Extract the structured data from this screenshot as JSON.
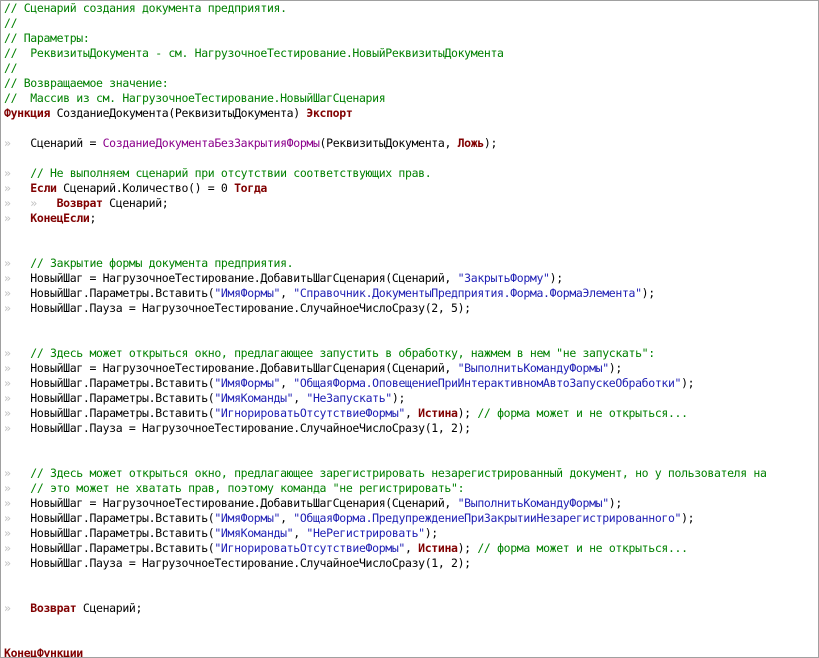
{
  "lines": [
    [
      {
        "t": "c",
        "v": "// Сценарий создания документа предприятия."
      }
    ],
    [
      {
        "t": "c",
        "v": "//"
      }
    ],
    [
      {
        "t": "c",
        "v": "// Параметры:"
      }
    ],
    [
      {
        "t": "c",
        "v": "//  РеквизитыДокумента - см. НагрузочноеТестирование.НовыйРеквизитыДокумента"
      }
    ],
    [
      {
        "t": "c",
        "v": "//"
      }
    ],
    [
      {
        "t": "c",
        "v": "// Возвращаемое значение:"
      }
    ],
    [
      {
        "t": "c",
        "v": "//  Массив из см. НагрузочноеТестирование.НовыйШагСценария"
      }
    ],
    [
      {
        "t": "k",
        "v": "Функция"
      },
      {
        "t": "p",
        "v": " СозданиеДокумента(РеквизитыДокумента) "
      },
      {
        "t": "k",
        "v": "Экспорт"
      }
    ],
    [],
    [
      {
        "t": "i",
        "v": "»   "
      },
      {
        "t": "p",
        "v": "Сценарий = "
      },
      {
        "t": "f",
        "v": "СозданиеДокументаБезЗакрытияФормы"
      },
      {
        "t": "p",
        "v": "(РеквизитыДокумента, "
      },
      {
        "t": "k",
        "v": "Ложь"
      },
      {
        "t": "p",
        "v": ");"
      }
    ],
    [],
    [
      {
        "t": "i",
        "v": "»   "
      },
      {
        "t": "c",
        "v": "// Не выполняем сценарий при отсутствии соответствующих прав."
      }
    ],
    [
      {
        "t": "i",
        "v": "»   "
      },
      {
        "t": "k",
        "v": "Если"
      },
      {
        "t": "p",
        "v": " Сценарий.Количество() = 0 "
      },
      {
        "t": "k",
        "v": "Тогда"
      }
    ],
    [
      {
        "t": "i",
        "v": "»   »   "
      },
      {
        "t": "k",
        "v": "Возврат"
      },
      {
        "t": "p",
        "v": " Сценарий;"
      }
    ],
    [
      {
        "t": "i",
        "v": "»   "
      },
      {
        "t": "k",
        "v": "КонецЕсли"
      },
      {
        "t": "p",
        "v": ";"
      }
    ],
    [],
    [],
    [
      {
        "t": "i",
        "v": "»   "
      },
      {
        "t": "c",
        "v": "// Закрытие формы документа предприятия."
      }
    ],
    [
      {
        "t": "i",
        "v": "»   "
      },
      {
        "t": "p",
        "v": "НовыйШаг = НагрузочноеТестирование.ДобавитьШагСценария(Сценарий, "
      },
      {
        "t": "s",
        "v": "\"ЗакрытьФорму\""
      },
      {
        "t": "p",
        "v": ");"
      }
    ],
    [
      {
        "t": "i",
        "v": "»   "
      },
      {
        "t": "p",
        "v": "НовыйШаг.Параметры.Вставить("
      },
      {
        "t": "s",
        "v": "\"ИмяФормы\""
      },
      {
        "t": "p",
        "v": ", "
      },
      {
        "t": "s",
        "v": "\"Справочник.ДокументыПредприятия.Форма.ФормаЭлемента\""
      },
      {
        "t": "p",
        "v": ");"
      }
    ],
    [
      {
        "t": "i",
        "v": "»   "
      },
      {
        "t": "p",
        "v": "НовыйШаг.Пауза = НагрузочноеТестирование.СлучайноеЧислоСразу(2, 5);"
      }
    ],
    [],
    [],
    [
      {
        "t": "i",
        "v": "»   "
      },
      {
        "t": "c",
        "v": "// Здесь может открыться окно, предлагающее запустить в обработку, нажмем в нем \"не запускать\":"
      }
    ],
    [
      {
        "t": "i",
        "v": "»   "
      },
      {
        "t": "p",
        "v": "НовыйШаг = НагрузочноеТестирование.ДобавитьШагСценария(Сценарий, "
      },
      {
        "t": "s",
        "v": "\"ВыполнитьКомандуФормы\""
      },
      {
        "t": "p",
        "v": ");"
      }
    ],
    [
      {
        "t": "i",
        "v": "»   "
      },
      {
        "t": "p",
        "v": "НовыйШаг.Параметры.Вставить("
      },
      {
        "t": "s",
        "v": "\"ИмяФормы\""
      },
      {
        "t": "p",
        "v": ", "
      },
      {
        "t": "s",
        "v": "\"ОбщаяФорма.ОповещениеПриИнтерактивномАвтоЗапускеОбработки\""
      },
      {
        "t": "p",
        "v": ");"
      }
    ],
    [
      {
        "t": "i",
        "v": "»   "
      },
      {
        "t": "p",
        "v": "НовыйШаг.Параметры.Вставить("
      },
      {
        "t": "s",
        "v": "\"ИмяКоманды\""
      },
      {
        "t": "p",
        "v": ", "
      },
      {
        "t": "s",
        "v": "\"НеЗапускать\""
      },
      {
        "t": "p",
        "v": ");"
      }
    ],
    [
      {
        "t": "i",
        "v": "»   "
      },
      {
        "t": "p",
        "v": "НовыйШаг.Параметры.Вставить("
      },
      {
        "t": "s",
        "v": "\"ИгнорироватьОтсутствиеФормы\""
      },
      {
        "t": "p",
        "v": ", "
      },
      {
        "t": "k",
        "v": "Истина"
      },
      {
        "t": "p",
        "v": "); "
      },
      {
        "t": "c",
        "v": "// форма может и не открыться..."
      }
    ],
    [
      {
        "t": "i",
        "v": "»   "
      },
      {
        "t": "p",
        "v": "НовыйШаг.Пауза = НагрузочноеТестирование.СлучайноеЧислоСразу(1, 2);"
      }
    ],
    [],
    [],
    [
      {
        "t": "i",
        "v": "»   "
      },
      {
        "t": "c",
        "v": "// Здесь может открыться окно, предлагающее зарегистрировать незарегистрированный документ, но у пользователя на"
      }
    ],
    [
      {
        "t": "i",
        "v": "»   "
      },
      {
        "t": "c",
        "v": "// это может не хватать прав, поэтому команда \"не регистрировать\":"
      }
    ],
    [
      {
        "t": "i",
        "v": "»   "
      },
      {
        "t": "p",
        "v": "НовыйШаг = НагрузочноеТестирование.ДобавитьШагСценария(Сценарий, "
      },
      {
        "t": "s",
        "v": "\"ВыполнитьКомандуФормы\""
      },
      {
        "t": "p",
        "v": ");"
      }
    ],
    [
      {
        "t": "i",
        "v": "»   "
      },
      {
        "t": "p",
        "v": "НовыйШаг.Параметры.Вставить("
      },
      {
        "t": "s",
        "v": "\"ИмяФормы\""
      },
      {
        "t": "p",
        "v": ", "
      },
      {
        "t": "s",
        "v": "\"ОбщаяФорма.ПредупреждениеПриЗакрытииНезарегистрированного\""
      },
      {
        "t": "p",
        "v": ");"
      }
    ],
    [
      {
        "t": "i",
        "v": "»   "
      },
      {
        "t": "p",
        "v": "НовыйШаг.Параметры.Вставить("
      },
      {
        "t": "s",
        "v": "\"ИмяКоманды\""
      },
      {
        "t": "p",
        "v": ", "
      },
      {
        "t": "s",
        "v": "\"НеРегистрировать\""
      },
      {
        "t": "p",
        "v": ");"
      }
    ],
    [
      {
        "t": "i",
        "v": "»   "
      },
      {
        "t": "p",
        "v": "НовыйШаг.Параметры.Вставить("
      },
      {
        "t": "s",
        "v": "\"ИгнорироватьОтсутствиеФормы\""
      },
      {
        "t": "p",
        "v": ", "
      },
      {
        "t": "k",
        "v": "Истина"
      },
      {
        "t": "p",
        "v": "); "
      },
      {
        "t": "c",
        "v": "// форма может и не открыться..."
      }
    ],
    [
      {
        "t": "i",
        "v": "»   "
      },
      {
        "t": "p",
        "v": "НовыйШаг.Пауза = НагрузочноеТестирование.СлучайноеЧислоСразу(1, 2);"
      }
    ],
    [],
    [],
    [
      {
        "t": "i",
        "v": "»   "
      },
      {
        "t": "k",
        "v": "Возврат"
      },
      {
        "t": "p",
        "v": " Сценарий;"
      }
    ],
    [],
    [],
    [
      {
        "t": "k",
        "v": "КонецФункции"
      }
    ]
  ]
}
